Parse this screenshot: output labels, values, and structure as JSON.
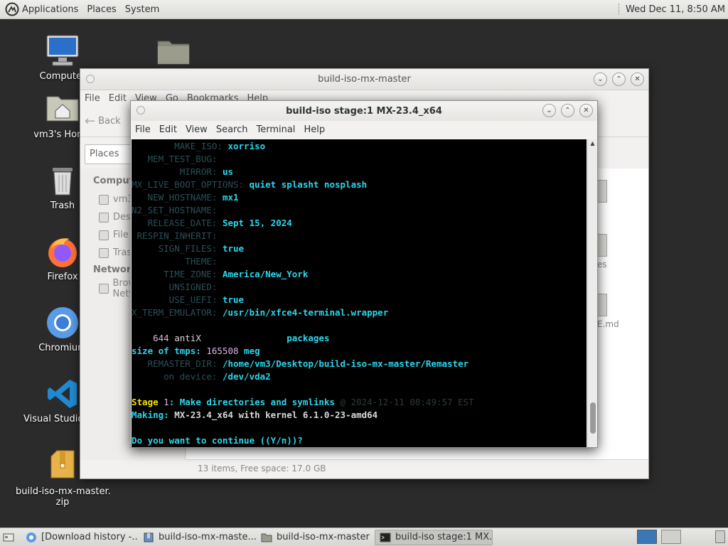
{
  "top_panel": {
    "menus": [
      "Applications",
      "Places",
      "System"
    ],
    "clock": "Wed Dec 11,  8:50 AM"
  },
  "desktop": {
    "icons": [
      {
        "label": "Computer",
        "icon": "computer-icon"
      },
      {
        "label": "",
        "icon": "folder-icon"
      },
      {
        "label": "vm3's Home",
        "icon": "home-folder-icon"
      },
      {
        "label": "Trash",
        "icon": "trash-icon"
      },
      {
        "label": "Firefox",
        "icon": "firefox-icon"
      },
      {
        "label": "Chromium",
        "icon": "chromium-icon"
      },
      {
        "label": "Visual Studio Code",
        "icon": "vscode-icon"
      },
      {
        "label": "build-iso-mx-master.",
        "label2": "zip",
        "icon": "zip-archive-icon"
      }
    ]
  },
  "file_manager": {
    "title": "build-iso-mx-master",
    "menus": [
      "File",
      "Edit",
      "View",
      "Go",
      "Bookmarks",
      "Help"
    ],
    "back_label": "Back",
    "places_label": "Places",
    "sidebar": {
      "computer_header": "Computer",
      "computer_items": [
        "vm3",
        "Desktop",
        "File System",
        "Trash"
      ],
      "network_header": "Network",
      "network_items": [
        "Browse Network"
      ]
    },
    "peek_labels": [
      "es",
      "E.md"
    ],
    "status": "13 items, Free space: 17.0 GB"
  },
  "terminal": {
    "title": "build-iso stage:1 MX-23.4_x64",
    "menus": [
      "File",
      "Edit",
      "View",
      "Search",
      "Terminal",
      "Help"
    ],
    "lines": [
      {
        "key": "        MAKE_ISO: ",
        "value": "xorriso"
      },
      {
        "key": "   MEM_TEST_BUG: ",
        "value": ""
      },
      {
        "key": "         MIRROR: ",
        "value": "us"
      },
      {
        "key": "MX_LIVE_BOOT_OPTIONS: ",
        "value": "quiet splasht nosplash"
      },
      {
        "key": "   NEW_HOSTNAME: ",
        "value": "mx1"
      },
      {
        "key": "N2_SET_HOSTNAME: ",
        "value": ""
      },
      {
        "key": "   RELEASE_DATE: ",
        "value": "Sept 15, 2024"
      },
      {
        "key": " RESPIN_INHERIT: ",
        "value": ""
      },
      {
        "key": "     SIGN_FILES: ",
        "value": "true"
      },
      {
        "key": "          THEME: ",
        "value": ""
      },
      {
        "key": "      TIME_ZONE: ",
        "value": "America/New_York"
      },
      {
        "key": "       UNSIGNED: ",
        "value": ""
      },
      {
        "key": "       USE_UEFI: ",
        "value": "true"
      },
      {
        "key": "X_TERM_EMULATOR: ",
        "value": "/usr/bin/xfce4-terminal.wrapper"
      }
    ],
    "pkg_count": "644",
    "pkg_name": "antiX",
    "pkg_word": "packages",
    "tmps_label": "size of tmps: ",
    "tmps_value": "165508",
    "tmps_unit": " meg",
    "remaster_key": "   REMASTER_DIR: ",
    "remaster_value": "/home/vm3/Desktop/build-iso-mx-master/Remaster",
    "ondevice_key": "      on device: ",
    "ondevice_value": "/dev/vda2",
    "stage_label": "Stage ",
    "stage_num": "1",
    "stage_text": ": Make directories and symlinks",
    "stage_time": " @ 2024-12-11 08:49:57 EST",
    "making_label": "Making: ",
    "making_value": "MX-23.4_x64 with kernel 6.1.0-23-amd64",
    "prompt": "Do you want to continue ((Y/n))?"
  },
  "taskbar": {
    "tasks": [
      {
        "label": "[Download history -...",
        "icon": "chromium-icon"
      },
      {
        "label": "build-iso-mx-maste...",
        "icon": "archive-manager-icon"
      },
      {
        "label": "build-iso-mx-master",
        "icon": "folder-icon"
      },
      {
        "label": "build-iso stage:1 MX...",
        "icon": "terminal-icon"
      }
    ]
  }
}
